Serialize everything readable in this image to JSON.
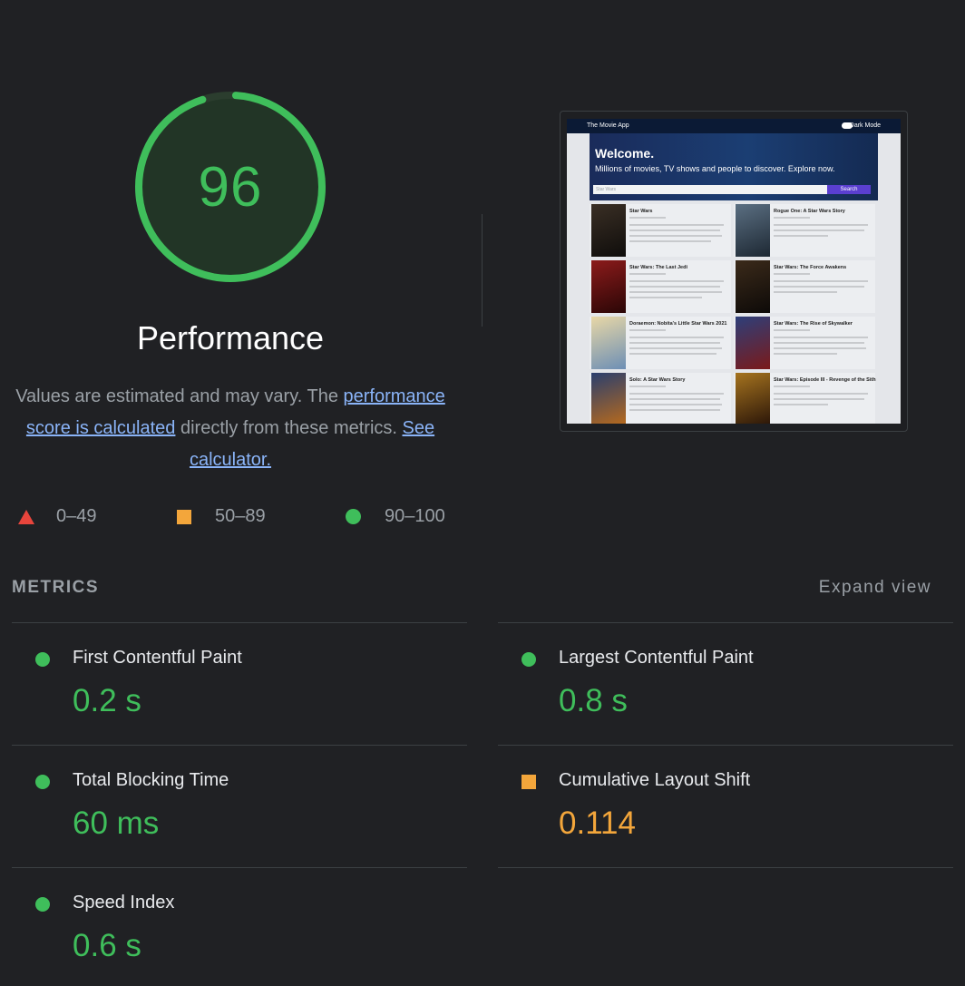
{
  "score": {
    "value": "96",
    "fraction": 0.96,
    "title": "Performance",
    "color": "#3fbe5b"
  },
  "description": {
    "prefix": "Values are estimated and may vary. The ",
    "link1": "performance score is calculated",
    "middle": " directly from these metrics. ",
    "link2": "See calculator."
  },
  "legend": [
    {
      "range": "0–49",
      "shape": "triangle",
      "color": "#e8453c"
    },
    {
      "range": "50–89",
      "shape": "square",
      "color": "#f3a63b"
    },
    {
      "range": "90–100",
      "shape": "circle",
      "color": "#3fbe5b"
    }
  ],
  "screenshot": {
    "app_name": "The Movie App",
    "dark_mode_label": "Dark Mode",
    "welcome": "Welcome.",
    "subtitle": "Millions of movies, TV shows and people to discover. Explore now.",
    "search_placeholder": "Star Wars",
    "search_button": "Search",
    "movies": [
      "Star Wars",
      "Rogue One: A Star Wars Story",
      "Star Wars: The Last Jedi",
      "Star Wars: The Force Awakens",
      "Doraemon: Nobita's Little Star Wars 2021",
      "Star Wars: The Rise of Skywalker",
      "Solo: A Star Wars Story",
      "Star Wars: Episode III - Revenge of the Sith"
    ]
  },
  "metrics": {
    "title": "METRICS",
    "expand_label": "Expand view",
    "items": [
      {
        "label": "First Contentful Paint",
        "value": "0.2 s",
        "rating": "good"
      },
      {
        "label": "Largest Contentful Paint",
        "value": "0.8 s",
        "rating": "good"
      },
      {
        "label": "Total Blocking Time",
        "value": "60 ms",
        "rating": "good"
      },
      {
        "label": "Cumulative Layout Shift",
        "value": "0.114",
        "rating": "average"
      },
      {
        "label": "Speed Index",
        "value": "0.6 s",
        "rating": "good"
      }
    ]
  }
}
